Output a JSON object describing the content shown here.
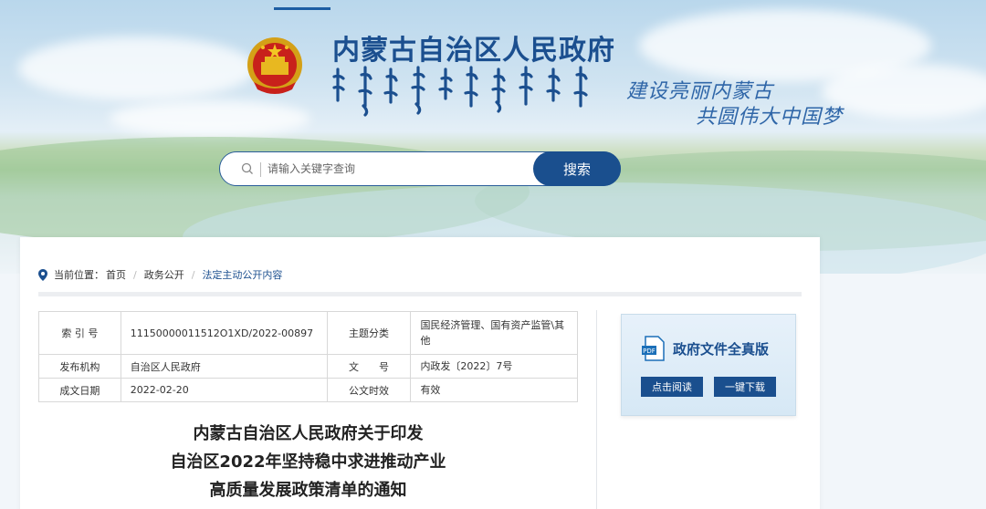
{
  "site": {
    "title": "内蒙古自治区人民政府",
    "slogan_line1": "建设亮丽内蒙古",
    "slogan_line2": "共圆伟大中国梦"
  },
  "search": {
    "placeholder": "请输入关键字查询",
    "button_label": "搜索"
  },
  "breadcrumb": {
    "prefix": "当前位置：",
    "items": [
      "首页",
      "政务公开",
      "法定主动公开内容"
    ]
  },
  "meta_table": {
    "rows": [
      {
        "label1": "索 引 号",
        "value1": "11150000011512O1XD/2022-00897",
        "label2": "主题分类",
        "value2": "国民经济管理、国有资产监管\\其他"
      },
      {
        "label1": "发布机构",
        "value1": "自治区人民政府",
        "label2": "文　　号",
        "value2": "内政发〔2022〕7号"
      },
      {
        "label1": "成文日期",
        "value1": "2022-02-20",
        "label2": "公文时效",
        "value2": "有效"
      }
    ]
  },
  "document": {
    "title_line1": "内蒙古自治区人民政府关于印发",
    "title_line2": "自治区2022年坚持稳中求进推动产业",
    "title_line3": "高质量发展政策清单的通知"
  },
  "full_version": {
    "title": "政府文件全真版",
    "read_label": "点击阅读",
    "download_label": "一键下载"
  },
  "colors": {
    "primary": "#1a4f8e",
    "title_blue": "#1b4f8f"
  }
}
